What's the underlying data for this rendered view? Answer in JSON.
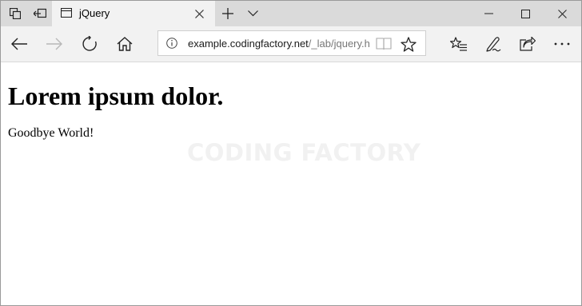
{
  "tab": {
    "title": "jQuery"
  },
  "address_bar": {
    "url_host": "example.codingfactory.net",
    "url_path": "/_lab/jquery.ht"
  },
  "page": {
    "heading": "Lorem ipsum dolor.",
    "paragraph": "Goodbye World!",
    "watermark": "CODING FACTORY"
  },
  "icons": {
    "tab_actions": "tab-actions-icon",
    "set_aside": "set-aside-tabs-icon",
    "page": "page-icon",
    "close": "close-icon",
    "new_tab": "plus-icon",
    "tab_list": "chevron-down-icon",
    "minimize": "minimize-icon",
    "maximize": "maximize-icon",
    "window_close": "close-icon",
    "back": "back-arrow-icon",
    "forward": "forward-arrow-icon",
    "refresh": "refresh-icon",
    "home": "home-icon",
    "info": "info-icon",
    "reading_view": "book-icon",
    "favorite": "star-icon",
    "favorites_hub": "favorites-list-icon",
    "notes": "pen-icon",
    "share": "share-icon",
    "more": "more-icon"
  },
  "colors": {
    "tabbar_bg": "#dadada",
    "active_tab_bg": "#f2f2f2",
    "toolbar_bg": "#f2f2f2",
    "url_path": "#777777",
    "watermark": "#f1f1f1"
  }
}
